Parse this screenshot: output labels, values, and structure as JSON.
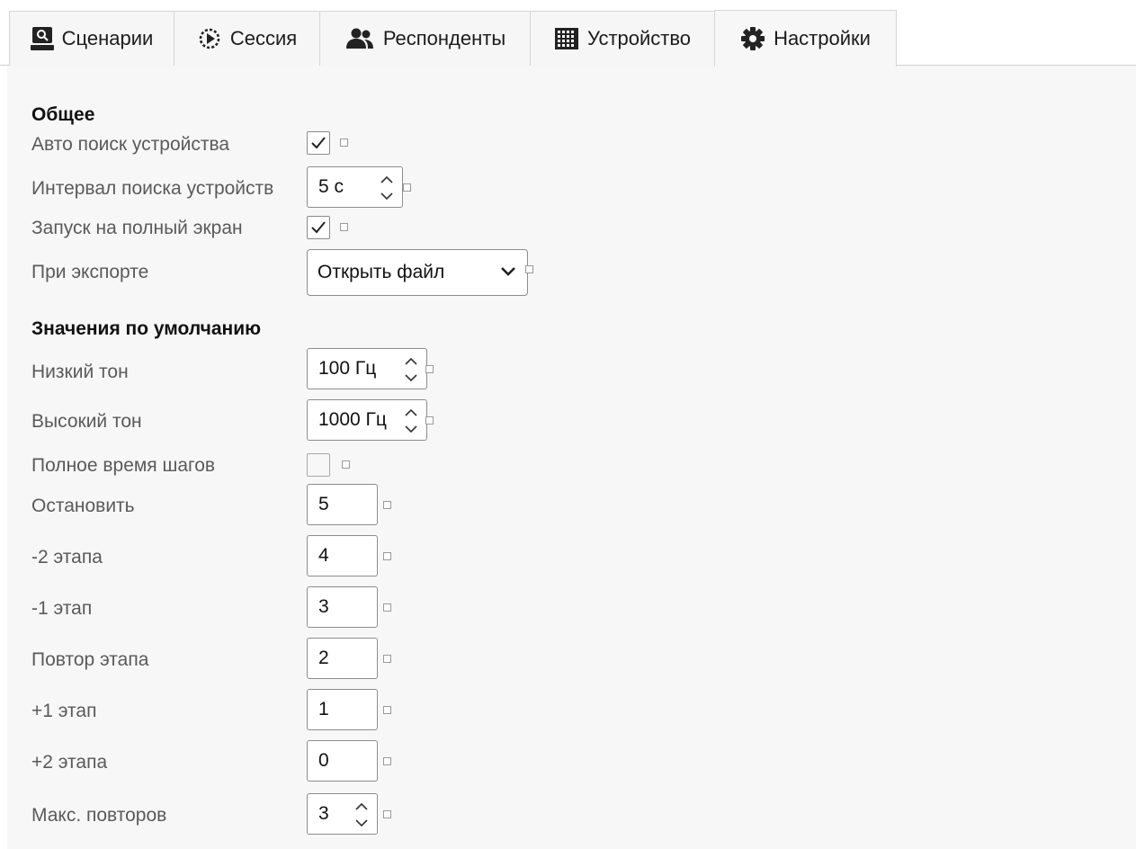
{
  "tabs": [
    {
      "label": "Сценарии",
      "icon": "scenario-icon",
      "active": false
    },
    {
      "label": "Сессия",
      "icon": "session-play-icon",
      "active": false
    },
    {
      "label": "Респонденты",
      "icon": "users-icon",
      "active": false
    },
    {
      "label": "Устройство",
      "icon": "device-grid-icon",
      "active": false
    },
    {
      "label": "Настройки",
      "icon": "gear-icon",
      "active": true
    }
  ],
  "general": {
    "title": "Общее",
    "auto_search": {
      "label": "Авто поиск устройства",
      "checked": true
    },
    "search_interval": {
      "label": "Интервал поиска устройств",
      "value": "5 с"
    },
    "fullscreen": {
      "label": "Запуск на полный экран",
      "checked": true
    },
    "on_export": {
      "label": "При экспорте",
      "value": "Открыть файл"
    }
  },
  "defaults": {
    "title": "Значения по умолчанию",
    "low_tone": {
      "label": "Низкий тон",
      "value": "100 Гц"
    },
    "high_tone": {
      "label": "Высокий тон",
      "value": "1000 Гц"
    },
    "full_step_time": {
      "label": "Полное время шагов",
      "checked": false
    },
    "stop": {
      "label": "Остановить",
      "value": "5"
    },
    "minus2": {
      "label": "-2 этапа",
      "value": "4"
    },
    "minus1": {
      "label": "-1 этап",
      "value": "3"
    },
    "repeat": {
      "label": "Повтор этапа",
      "value": "2"
    },
    "plus1": {
      "label": "+1 этап",
      "value": "1"
    },
    "plus2": {
      "label": "+2 этапа",
      "value": "0"
    },
    "max_repeats": {
      "label": "Макс. повторов",
      "value": "3"
    }
  },
  "colors": {
    "panel_bg": "#f7f7f7",
    "tab_border": "#d6d6d6",
    "field_border": "#8c8c8c"
  }
}
